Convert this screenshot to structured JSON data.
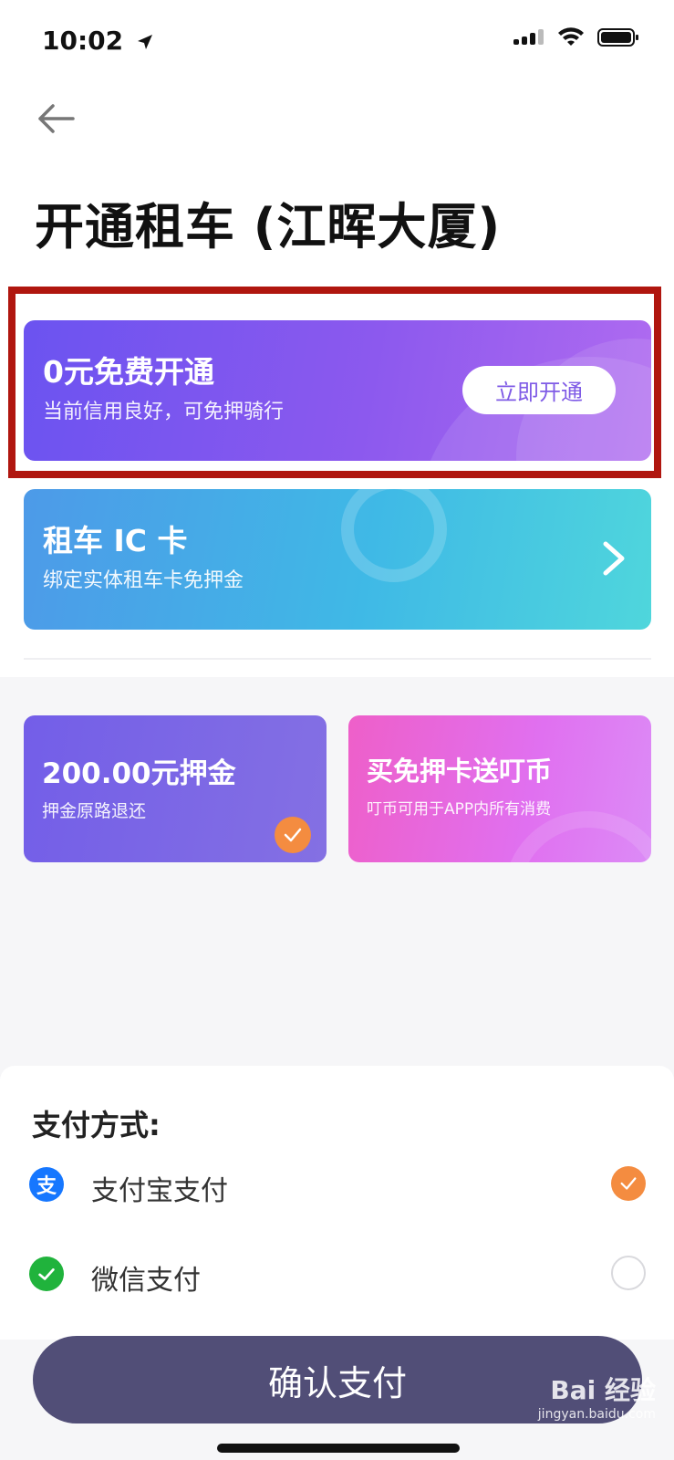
{
  "status_bar": {
    "time": "10:02"
  },
  "header": {
    "title": "开通租车 (江晖大厦)"
  },
  "free_card": {
    "title": "0元免费开通",
    "subtitle": "当前信用良好，可免押骑行",
    "button_label": "立即开通"
  },
  "ic_card": {
    "title": "租车 IC 卡",
    "subtitle": "绑定实体租车卡免押金"
  },
  "deposit_card": {
    "title": "200.00元押金",
    "subtitle": "押金原路退还",
    "selected": true
  },
  "buy_card": {
    "title": "买免押卡送叮币",
    "subtitle": "叮币可用于APP内所有消费"
  },
  "payment": {
    "title": "支付方式:",
    "methods": [
      {
        "label": "支付宝支付",
        "icon": "alipay-icon",
        "color": "#1677ff",
        "selected": true
      },
      {
        "label": "微信支付",
        "icon": "wechat-pay-icon",
        "color": "#20b33c",
        "selected": false
      }
    ]
  },
  "confirm_button": {
    "label": "确认支付"
  },
  "watermark": {
    "text": "Bai 经验",
    "url_text": "jingyan.baidu.com"
  }
}
